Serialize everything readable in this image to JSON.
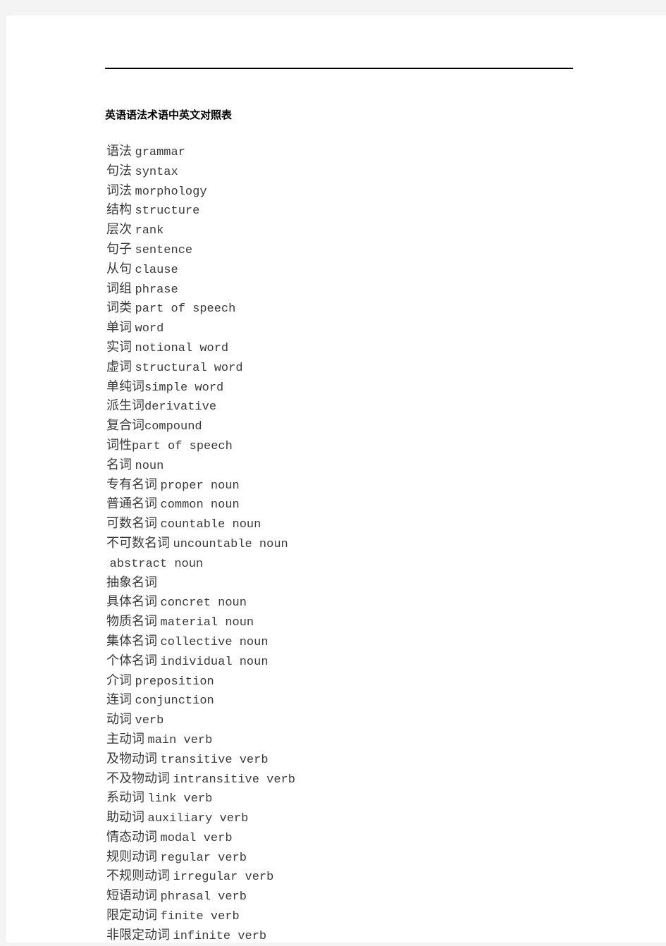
{
  "document": {
    "title": "英语语法术语中英文对照表",
    "header_rule": "horizontal-rule"
  },
  "terms": [
    {
      "zh": "语法",
      "sep": " ",
      "en": "grammar"
    },
    {
      "zh": "句法",
      "sep": " ",
      "en": "syntax"
    },
    {
      "zh": "词法",
      "sep": " ",
      "en": "morphology"
    },
    {
      "zh": "结构",
      "sep": " ",
      "en": "structure"
    },
    {
      "zh": "层次",
      "sep": " ",
      "en": "rank"
    },
    {
      "zh": "句子",
      "sep": " ",
      "en": "sentence"
    },
    {
      "zh": "从句",
      "sep": " ",
      "en": "clause"
    },
    {
      "zh": "词组",
      "sep": " ",
      "en": "phrase"
    },
    {
      "zh": "词类",
      "sep": " ",
      "en": "part of speech"
    },
    {
      "zh": "单词",
      "sep": " ",
      "en": "word"
    },
    {
      "zh": "实词",
      "sep": " ",
      "en": "notional word"
    },
    {
      "zh": "虚词",
      "sep": " ",
      "en": "structural word"
    },
    {
      "zh": "单纯词",
      "sep": "",
      "en": "simple word"
    },
    {
      "zh": "派生词",
      "sep": "",
      "en": "derivative"
    },
    {
      "zh": "复合词",
      "sep": "",
      "en": "compound"
    },
    {
      "zh": "词性",
      "sep": "",
      "en": "part of speech"
    },
    {
      "zh": "名词",
      "sep": " ",
      "en": "noun"
    },
    {
      "zh": "专有名词",
      "sep": " ",
      "en": "proper noun"
    },
    {
      "zh": "普通名词",
      "sep": " ",
      "en": "common noun"
    },
    {
      "zh": "可数名词",
      "sep": " ",
      "en": "countable noun"
    },
    {
      "zh": "不可数名词",
      "sep": " ",
      "en": "uncountable noun"
    },
    {
      "zh": "",
      "sep": " ",
      "en": "abstract noun"
    },
    {
      "zh": "抽象名词",
      "sep": "",
      "en": ""
    },
    {
      "zh": "具体名词",
      "sep": " ",
      "en": "concret noun"
    },
    {
      "zh": "物质名词",
      "sep": " ",
      "en": "material noun"
    },
    {
      "zh": "集体名词",
      "sep": " ",
      "en": "collective noun"
    },
    {
      "zh": "个体名词",
      "sep": " ",
      "en": "individual noun"
    },
    {
      "zh": "介词",
      "sep": " ",
      "en": "preposition"
    },
    {
      "zh": "连词",
      "sep": " ",
      "en": "conjunction"
    },
    {
      "zh": "动词",
      "sep": " ",
      "en": "verb"
    },
    {
      "zh": "主动词",
      "sep": " ",
      "en": "main verb"
    },
    {
      "zh": "及物动词",
      "sep": " ",
      "en": "transitive verb"
    },
    {
      "zh": "不及物动词",
      "sep": " ",
      "en": "intransitive verb"
    },
    {
      "zh": "系动词",
      "sep": " ",
      "en": "link verb"
    },
    {
      "zh": "助动词",
      "sep": " ",
      "en": "auxiliary verb"
    },
    {
      "zh": "情态动词",
      "sep": " ",
      "en": "modal verb"
    },
    {
      "zh": "规则动词",
      "sep": " ",
      "en": "regular verb"
    },
    {
      "zh": "不规则动词",
      "sep": " ",
      "en": "irregular verb"
    },
    {
      "zh": "短语动词",
      "sep": " ",
      "en": "phrasal verb"
    },
    {
      "zh": "限定动词",
      "sep": " ",
      "en": "finite verb"
    },
    {
      "zh": "非限定动词",
      "sep": " ",
      "en": "infinite verb"
    }
  ]
}
